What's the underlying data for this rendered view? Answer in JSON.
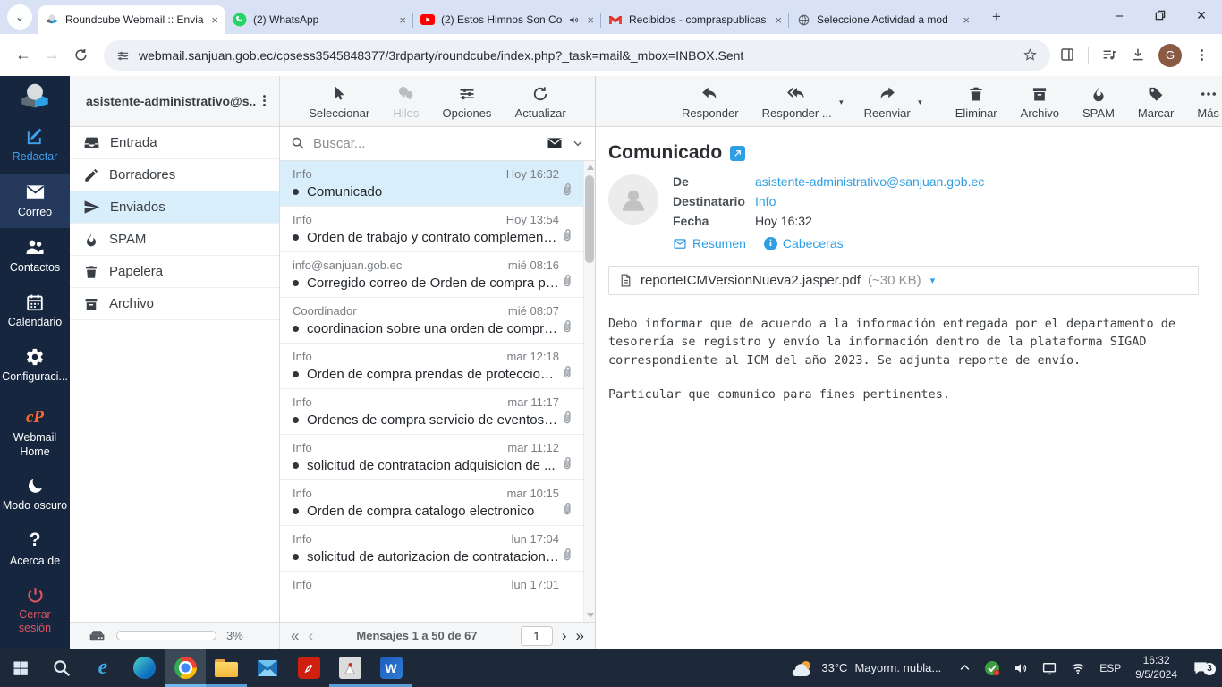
{
  "colors": {
    "accent_blue": "#2f9fe3",
    "rail_bg": "#16263f",
    "selected_row": "#d9eefb",
    "tabstrip_bg": "#d8e2f4",
    "taskbar_bg": "#1d2939",
    "logout_red": "#e2555f",
    "cpanel_orange": "#ff6c2c"
  },
  "glyphs": {
    "tab_search": "⌄",
    "close_tab": "×",
    "new_tab": "+",
    "win_min": "–",
    "win_close": "×",
    "back": "←",
    "forward": "→",
    "kebab": "⋮",
    "caret_down": "▾",
    "pg_first": "«",
    "pg_prev": "‹",
    "pg_next": "›",
    "pg_last": "»"
  },
  "browser": {
    "tabs": [
      {
        "title": "Roundcube Webmail :: Envia",
        "favicon": "roundcube-icon"
      },
      {
        "title": "(2) WhatsApp",
        "favicon": "whatsapp-icon"
      },
      {
        "title": "(2) Estos Himnos Son Co",
        "favicon": "youtube-icon",
        "audio": "playing"
      },
      {
        "title": "Recibidos - compraspublicas",
        "favicon": "gmail-icon"
      },
      {
        "title": "Seleccione Actividad a mod",
        "favicon": "globe-icon"
      }
    ],
    "url": "webmail.sanjuan.gob.ec/cpsess3545848377/3rdparty/roundcube/index.php?_task=mail&_mbox=INBOX.Sent",
    "profile_initial": "G"
  },
  "rail": {
    "items": [
      {
        "label": "Redactar"
      },
      {
        "label": "Correo"
      },
      {
        "label": "Contactos"
      },
      {
        "label": "Calendario"
      },
      {
        "label": "Configuraci..."
      },
      {
        "label": "Webmail Home"
      },
      {
        "label": "Modo oscuro"
      },
      {
        "label": "Acerca de"
      },
      {
        "label": "Cerrar sesión"
      }
    ]
  },
  "folders": {
    "account": "asistente-administrativo@s...",
    "items": [
      {
        "label": "Entrada"
      },
      {
        "label": "Borradores"
      },
      {
        "label": "Enviados"
      },
      {
        "label": "SPAM"
      },
      {
        "label": "Papelera"
      },
      {
        "label": "Archivo"
      }
    ],
    "quota_percent": "3%"
  },
  "list": {
    "toolbar": {
      "select": "Seleccionar",
      "threads": "Hilos",
      "options": "Opciones",
      "refresh": "Actualizar"
    },
    "search_placeholder": "Buscar...",
    "messages": [
      {
        "sender": "Info",
        "date": "Hoy 16:32",
        "subject": "Comunicado"
      },
      {
        "sender": "Info",
        "date": "Hoy 13:54",
        "subject": "Orden de trabajo y contrato complementa..."
      },
      {
        "sender": "info@sanjuan.gob.ec",
        "date": "mié 08:16",
        "subject": "Corregido correo de Orden de compra pre..."
      },
      {
        "sender": "Coordinador",
        "date": "mié 08:07",
        "subject": "coordinacion sobre una orden de compra ..."
      },
      {
        "sender": "Info",
        "date": "mar 12:18",
        "subject": "Orden de compra prendas de proteccion ..."
      },
      {
        "sender": "Info",
        "date": "mar 11:17",
        "subject": "Ordenes de compra servicio de eventos c..."
      },
      {
        "sender": "Info",
        "date": "mar 11:12",
        "subject": "solicitud de contratacion adquisicion de ..."
      },
      {
        "sender": "Info",
        "date": "mar 10:15",
        "subject": "Orden de compra catalogo electronico"
      },
      {
        "sender": "Info",
        "date": "lun 17:04",
        "subject": "solicitud de autorizacion de contratacion ..."
      },
      {
        "sender": "Info",
        "date": "lun 17:01",
        "subject": ""
      }
    ],
    "pagination": {
      "label": "Mensajes 1 a 50 de 67",
      "page": "1"
    }
  },
  "reading": {
    "toolbar": {
      "reply": "Responder",
      "reply_all": "Responder ...",
      "forward": "Reenviar",
      "delete": "Eliminar",
      "archive": "Archivo",
      "spam": "SPAM",
      "mark": "Marcar",
      "more": "Más"
    },
    "title": "Comunicado",
    "meta": {
      "from_label": "De",
      "from": "asistente-administrativo@sanjuan.gob.ec",
      "to_label": "Destinatario",
      "to": "Info",
      "date_label": "Fecha",
      "date": "Hoy 16:32"
    },
    "actions": {
      "summary": "Resumen",
      "headers": "Cabeceras"
    },
    "attachment": {
      "name": "reporteICMVersionNueva2.jasper.pdf",
      "size": "(~30 KB)"
    },
    "body": [
      "Debo informar que de acuerdo a la información entregada por el departamento de tesorería se registro y envío la información dentro de la plataforma SIGAD correspondiente al ICM del año 2023. Se adjunta reporte de envío.",
      "Particular que comunico para fines pertinentes."
    ]
  },
  "taskbar": {
    "weather_temp": "33°C",
    "weather_desc": "Mayorm. nubla...",
    "lang": "ESP",
    "time": "16:32",
    "date": "9/5/2024",
    "badge": "3"
  }
}
